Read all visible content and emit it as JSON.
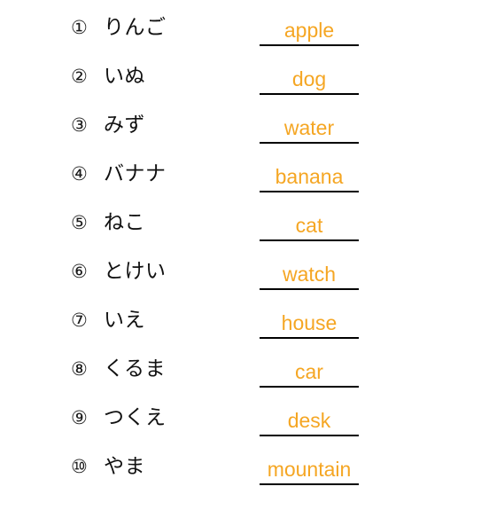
{
  "document": {
    "kind": "vocabulary-worksheet",
    "background_color": "#ffffff",
    "prompt_color": "#111111",
    "answer_color": "#f5a623",
    "rule_color": "#000000"
  },
  "rows": [
    {
      "number": "①",
      "prompt": "りんご",
      "answer": "apple"
    },
    {
      "number": "②",
      "prompt": "いぬ",
      "answer": "dog"
    },
    {
      "number": "③",
      "prompt": "みず",
      "answer": "water"
    },
    {
      "number": "④",
      "prompt": "バナナ",
      "answer": "banana"
    },
    {
      "number": "⑤",
      "prompt": "ねこ",
      "answer": "cat"
    },
    {
      "number": "⑥",
      "prompt": "とけい",
      "answer": "watch"
    },
    {
      "number": "⑦",
      "prompt": "いえ",
      "answer": "house"
    },
    {
      "number": "⑧",
      "prompt": "くるま",
      "answer": "car"
    },
    {
      "number": "⑨",
      "prompt": "つくえ",
      "answer": "desk"
    },
    {
      "number": "⑩",
      "prompt": "やま",
      "answer": "mountain"
    }
  ]
}
